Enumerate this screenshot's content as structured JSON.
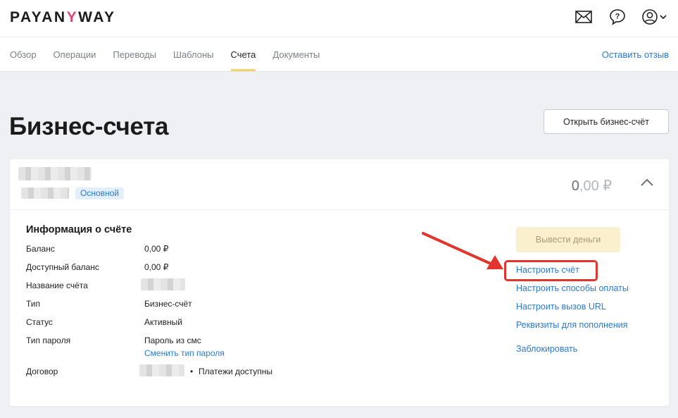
{
  "header": {
    "logo": {
      "part1": "PAYAN",
      "part2": "Y",
      "part3": "WAY"
    },
    "icons": [
      "mail-icon",
      "help-icon",
      "user-icon"
    ]
  },
  "nav": {
    "items": [
      "Обзор",
      "Операции",
      "Переводы",
      "Шаблоны",
      "Счета",
      "Документы"
    ],
    "active": "Счета",
    "feedback": "Оставить отзыв"
  },
  "page": {
    "title": "Бизнес-счета",
    "open_button": "Открыть бизнес-счёт"
  },
  "account": {
    "badge": "Основной",
    "amount_int": "0",
    "amount_frac": ",00 ₽",
    "info_title": "Информация о счёте",
    "rows": [
      {
        "label": "Баланс",
        "value": "0,00 ₽"
      },
      {
        "label": "Доступный баланс",
        "value": "0,00 ₽"
      },
      {
        "label": "Название счёта",
        "value": ""
      },
      {
        "label": "Тип",
        "value": "Бизнес-счёт"
      },
      {
        "label": "Статус",
        "value": "Активный"
      },
      {
        "label": "Тип пароля",
        "value": "Пароль из смс",
        "link": "Сменить тип пароля"
      },
      {
        "label": "Договор",
        "value": "",
        "bullet": "•",
        "extra": "Платежи доступны"
      }
    ],
    "withdraw_button": "Вывести деньги",
    "actions": [
      "Настроить счёт",
      "Настроить способы оплаты",
      "Настроить вызов URL",
      "Реквизиты для пополнения",
      "Заблокировать"
    ]
  },
  "colors": {
    "accent_blue": "#2a7ad8",
    "highlight_red": "#e1352d",
    "tab_underline": "#f5d36b"
  }
}
